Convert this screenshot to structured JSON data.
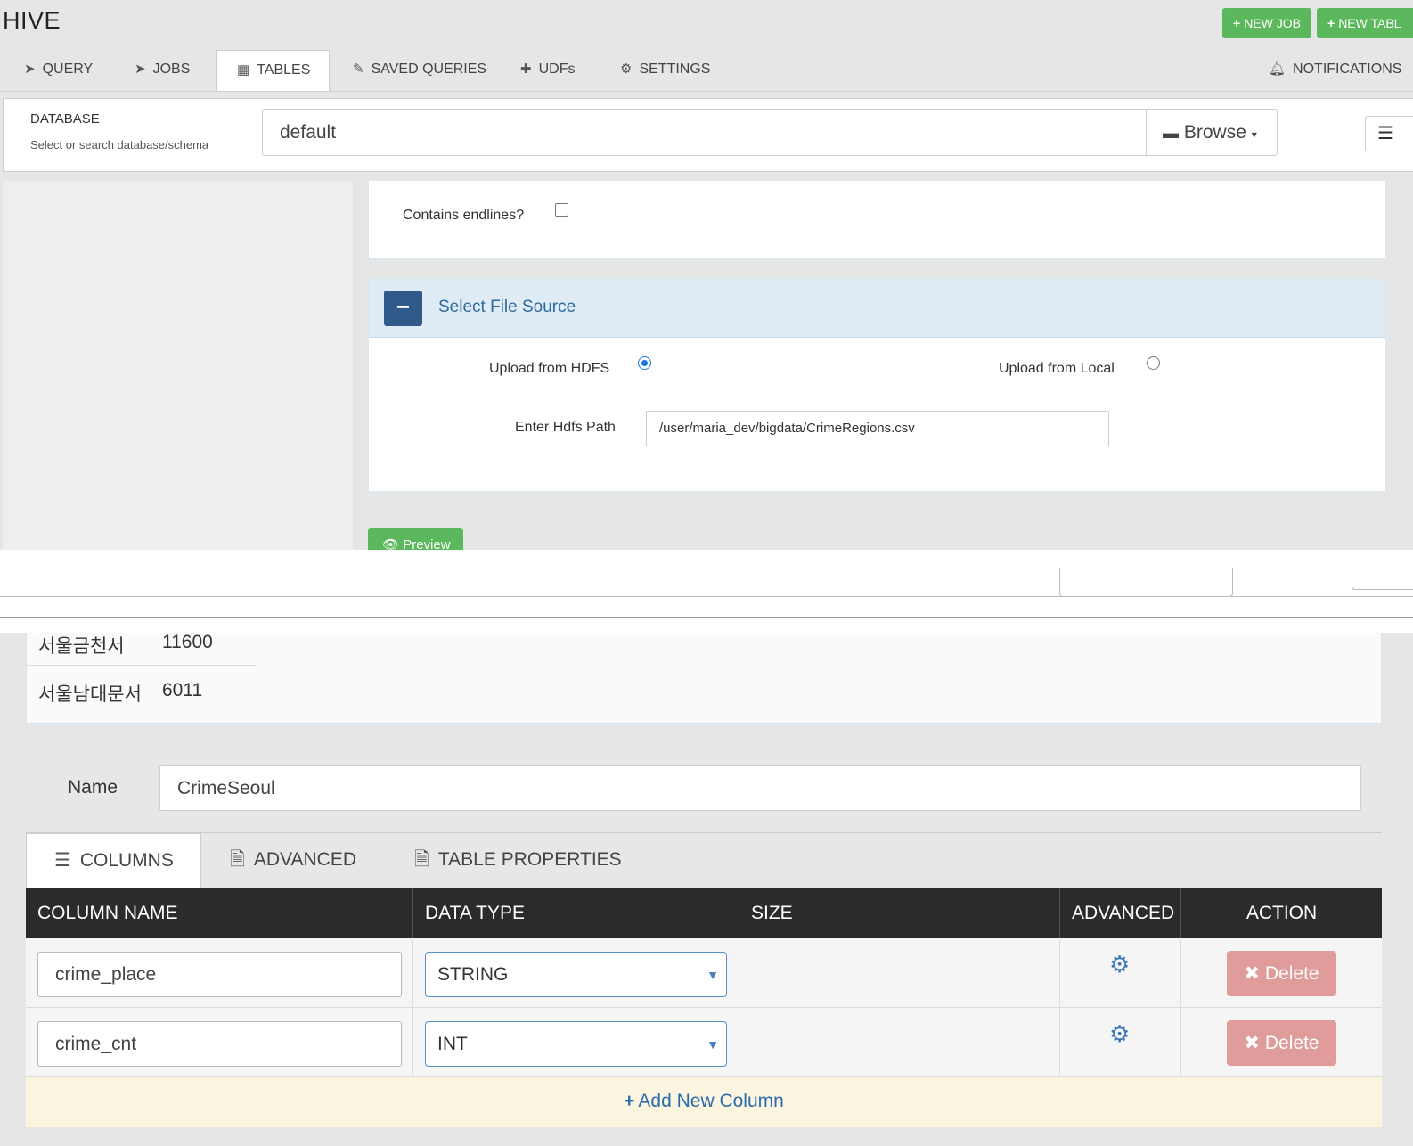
{
  "app": {
    "title": "HIVE"
  },
  "header_buttons": {
    "new_job": "NEW JOB",
    "new_table": "NEW TABL"
  },
  "nav": {
    "tabs": [
      {
        "label": "QUERY",
        "icon": "paper-plane-icon"
      },
      {
        "label": "JOBS",
        "icon": "paper-plane-icon"
      },
      {
        "label": "TABLES",
        "icon": "table-icon"
      },
      {
        "label": "SAVED QUERIES",
        "icon": "paperclip-icon"
      },
      {
        "label": "UDFs",
        "icon": "puzzle-icon"
      },
      {
        "label": "SETTINGS",
        "icon": "gear-icon"
      }
    ],
    "active_tab": "TABLES",
    "notifications": "NOTIFICATIONS"
  },
  "database": {
    "label": "DATABASE",
    "sublabel": "Select or search database/schema",
    "value": "default",
    "browse_label": "Browse"
  },
  "upload_form": {
    "contains_endlines_label": "Contains endlines?",
    "contains_endlines_checked": false,
    "section_title": "Select File Source",
    "upload_hdfs_label": "Upload from HDFS",
    "upload_local_label": "Upload from Local",
    "selected_source": "hdfs",
    "hdfs_path_label": "Enter Hdfs Path",
    "hdfs_path_value": "/user/maria_dev/bigdata/CrimeRegions.csv",
    "preview_label": "Preview"
  },
  "preview_rows": [
    {
      "place": "서울금천서",
      "count": "11600"
    },
    {
      "place": "서울남대문서",
      "count": "6011"
    }
  ],
  "table_form": {
    "name_label": "Name",
    "name_value": "CrimeSeoul",
    "tabs": [
      "COLUMNS",
      "ADVANCED",
      "TABLE PROPERTIES"
    ],
    "active_tab": "COLUMNS",
    "headers": [
      "COLUMN NAME",
      "DATA TYPE",
      "SIZE",
      "ADVANCED",
      "ACTION"
    ],
    "rows": [
      {
        "name": "crime_place",
        "type": "STRING",
        "size": "",
        "action": "Delete"
      },
      {
        "name": "crime_cnt",
        "type": "INT",
        "size": "",
        "action": "Delete"
      }
    ],
    "add_column_label": "Add New Column"
  },
  "colors": {
    "green": "#5cb85c",
    "dark_blue": "#305a8c",
    "delete_red": "#e09b9b",
    "header_dark": "#2b2b2b",
    "add_row_bg": "#fbf4de"
  }
}
